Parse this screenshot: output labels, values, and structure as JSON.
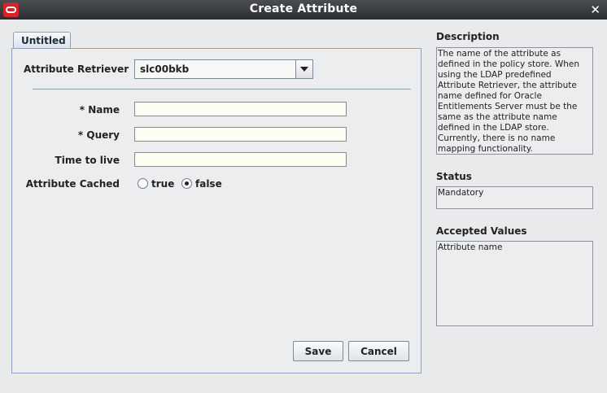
{
  "window": {
    "title": "Create Attribute",
    "close_icon": "close-icon",
    "app_icon": "oracle-logo-icon"
  },
  "tab": {
    "label": "Untitled"
  },
  "form": {
    "retriever_label": "Attribute Retriever",
    "retriever_value": "slc00bkb",
    "name_label": "* Name",
    "name_value": "",
    "query_label": "* Query",
    "query_value": "",
    "ttl_label": "Time to live",
    "ttl_value": "",
    "cached_label": "Attribute Cached",
    "cached_options": [
      "true",
      "false"
    ],
    "cached_selected": "false"
  },
  "buttons": {
    "save": "Save",
    "cancel": "Cancel"
  },
  "side": {
    "description_title": "Description",
    "description_text": "The name of the attribute as defined in the policy store. When using the LDAP predefined Attribute Retriever, the attribute name defined for Oracle Entitlements Server must be the same as the attribute name defined in the LDAP store. Currently, there is no name mapping functionality.",
    "status_title": "Status",
    "status_value": "Mandatory",
    "accepted_title": "Accepted Values",
    "accepted_value": "Attribute name"
  }
}
